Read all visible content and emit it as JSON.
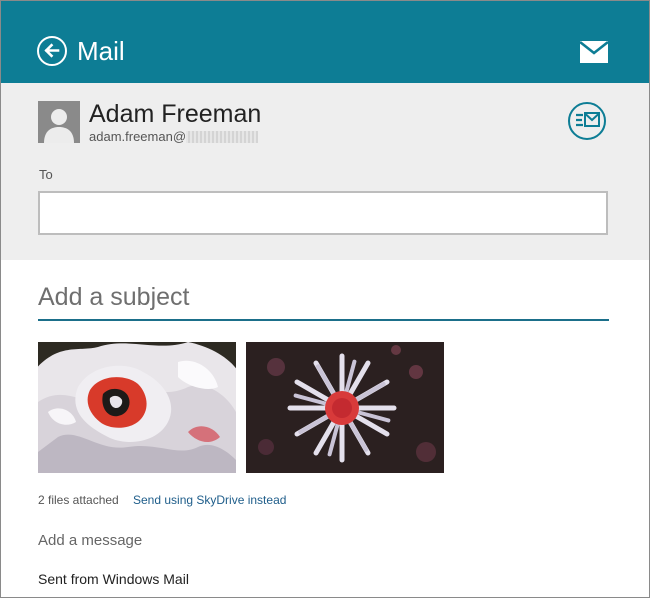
{
  "header": {
    "app_title": "Mail",
    "bar_color": "#0d7d95",
    "back_icon": "back-arrow-icon",
    "mail_icon": "envelope-icon"
  },
  "compose": {
    "sender_name": "Adam Freeman",
    "sender_email_prefix": "adam.freeman@",
    "send_icon": "send-mail-icon",
    "to_label": "To",
    "to_value": "",
    "subject_placeholder": "Add a subject",
    "subject_value": ""
  },
  "attachments": {
    "count_text": "2 files attached",
    "skydrive_link": "Send using SkyDrive instead",
    "items": [
      {
        "name": "carnation-photo"
      },
      {
        "name": "daisy-photo"
      }
    ]
  },
  "message": {
    "placeholder": "Add a message",
    "signature": "Sent from Windows Mail"
  }
}
